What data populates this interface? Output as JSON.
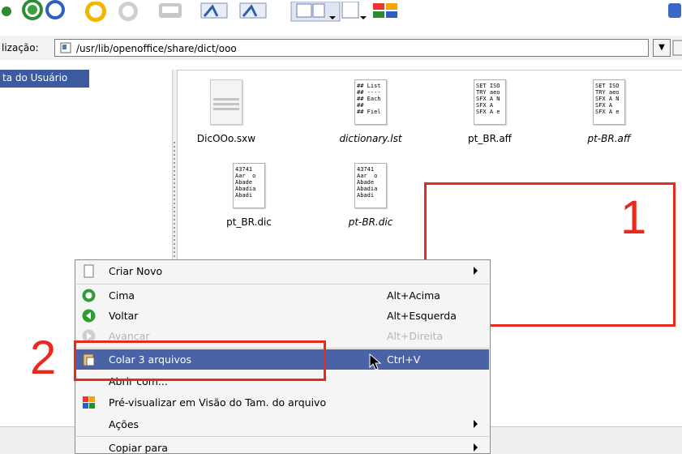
{
  "location": {
    "label": "lização:",
    "path": "/usr/lib/openoffice/share/dict/ooo"
  },
  "sidebar": {
    "selected_item": "ta do Usuário"
  },
  "files": [
    {
      "name": "DicOOo.sxw",
      "italic": false,
      "thumb": "document"
    },
    {
      "name": "dictionary.lst",
      "italic": true,
      "thumb": "## List\n## ----\n## Each\n##\n## Fiel"
    },
    {
      "name": "pt_BR.aff",
      "italic": false,
      "thumb": "SET ISO\nTRY aeo\nSFX A N\nSFX A\nSFX A e"
    },
    {
      "name": "pt-BR.aff",
      "italic": true,
      "thumb": "SET ISO\nTRY aeo\nSFX A N\nSFX A\nSFX A e"
    },
    {
      "name": "pt_BR.dic",
      "italic": false,
      "thumb": "43741\nAar  o\nAbade\nAbadia\nAbadi"
    },
    {
      "name": "pt-BR.dic",
      "italic": true,
      "thumb": "43741\nAar  o\nAbade\nAbadia\nAbadi"
    }
  ],
  "annotations": {
    "label_1": "1",
    "label_2": "2",
    "color": "#e8291c"
  },
  "context_menu": {
    "items": [
      {
        "label": "Criar Novo",
        "shortcut": "",
        "submenu": true,
        "icon": "blank-page-icon"
      },
      {
        "label": "Cima",
        "shortcut": "Alt+Acima",
        "icon": "up-arrow-icon"
      },
      {
        "label": "Voltar",
        "shortcut": "Alt+Esquerda",
        "icon": "back-arrow-icon"
      },
      {
        "label": "Avançar",
        "shortcut": "Alt+Direita",
        "disabled": true,
        "icon": "forward-arrow-icon"
      },
      {
        "label": "Colar 3 arquivos",
        "shortcut": "Ctrl+V",
        "selected": true,
        "icon": "paste-icon"
      },
      {
        "label": "Abrir com...",
        "shortcut": "",
        "icon": ""
      },
      {
        "label": "Pré-visualizar em Visão do Tam. do arquivo",
        "shortcut": "",
        "icon": "preview-icon"
      },
      {
        "label": "Ações",
        "shortcut": "",
        "submenu": true,
        "icon": ""
      },
      {
        "label": "Copiar para",
        "shortcut": "",
        "submenu": true,
        "icon": ""
      }
    ]
  },
  "colors": {
    "selection": "#4a62a6",
    "sidebar_selection": "#3b5b9e"
  }
}
